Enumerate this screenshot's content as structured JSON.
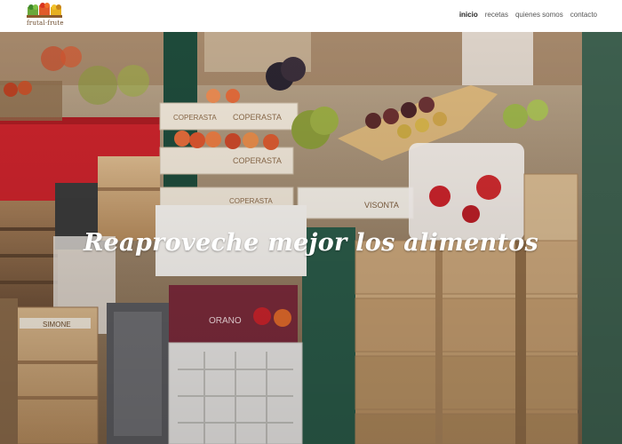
{
  "brand": {
    "name": "frutal·frute",
    "logo_icon": "fruit-crates-logo-icon"
  },
  "nav": {
    "items": [
      {
        "label": "inicio",
        "active": true
      },
      {
        "label": "recetas",
        "active": false
      },
      {
        "label": "quienes somos",
        "active": false
      },
      {
        "label": "contacto",
        "active": false
      }
    ]
  },
  "hero": {
    "title": "Reaproveche mejor los alimentos",
    "crate_labels": [
      "COPERASTA",
      "COPERASTA",
      "COPERASTA",
      "VISONTA",
      "SIMONE",
      "ORANO"
    ]
  },
  "colors": {
    "accent_red": "#c8232b",
    "wood": "#c9a57a",
    "header_bg": "#ffffff"
  }
}
